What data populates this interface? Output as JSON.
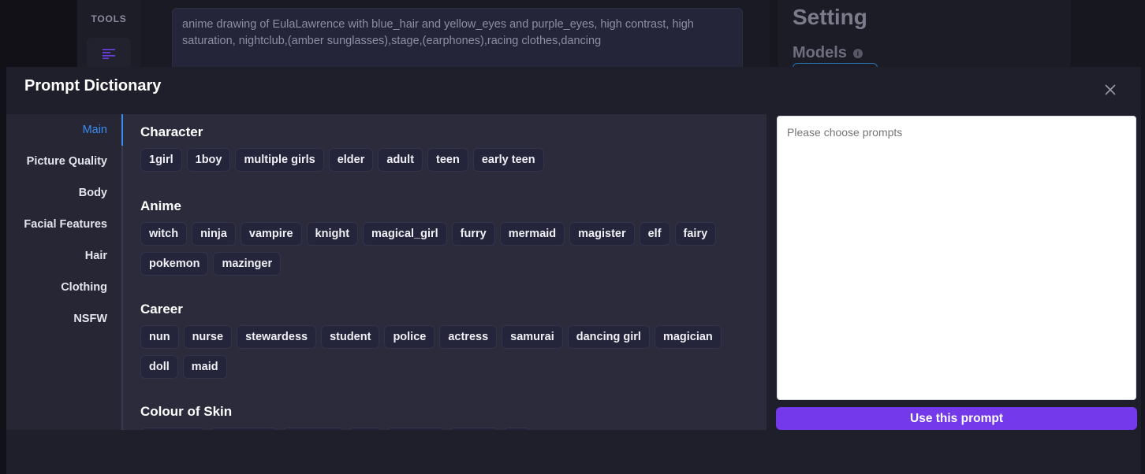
{
  "background": {
    "tools_label": "TOOLS",
    "prompt_text": "anime drawing of EulaLawrence with blue_hair and yellow_eyes and purple_eyes, high contrast, high saturation, nightclub,(amber sunglasses),stage,(earphones),racing clothes,dancing",
    "setting_title": "Setting",
    "models_label": "Models"
  },
  "modal": {
    "title": "Prompt Dictionary",
    "sidebar": [
      {
        "label": "Main",
        "active": true
      },
      {
        "label": "Picture Quality"
      },
      {
        "label": "Body"
      },
      {
        "label": "Facial Features"
      },
      {
        "label": "Hair"
      },
      {
        "label": "Clothing"
      },
      {
        "label": "NSFW"
      }
    ],
    "sections": [
      {
        "title": "Character",
        "tags": [
          "1girl",
          "1boy",
          "multiple girls",
          "elder",
          "adult",
          "teen",
          "early teen"
        ]
      },
      {
        "title": "Anime",
        "tags": [
          "witch",
          "ninja",
          "vampire",
          "knight",
          "magical_girl",
          "furry",
          "mermaid",
          "magister",
          "elf",
          "fairy",
          "pokemon",
          "mazinger"
        ]
      },
      {
        "title": "Career",
        "tags": [
          "nun",
          "nurse",
          "stewardess",
          "student",
          "police",
          "actress",
          "samurai",
          "dancing girl",
          "magician",
          "doll",
          "maid"
        ]
      },
      {
        "title": "Colour of Skin",
        "tags": []
      }
    ],
    "result_placeholder": "Please choose prompts",
    "use_button": "Use this prompt"
  },
  "colors": {
    "accent": "#7339ea",
    "active_link": "#3b8cf0",
    "background": "#17171f"
  }
}
